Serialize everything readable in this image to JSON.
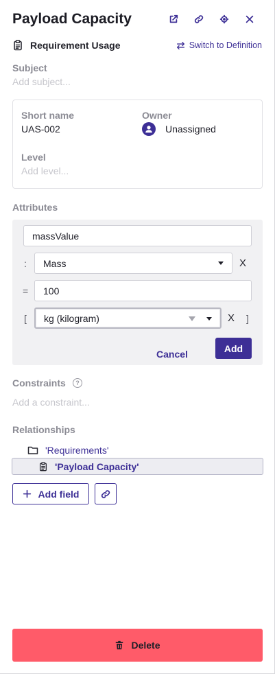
{
  "header": {
    "title": "Payload Capacity",
    "icons": [
      "external-link-icon",
      "link-icon",
      "target-icon",
      "close-icon"
    ]
  },
  "subheader": {
    "kind": "Requirement Usage",
    "switch_label": "Switch to Definition"
  },
  "subject": {
    "label": "Subject",
    "placeholder": "Add subject..."
  },
  "details": {
    "short_name_label": "Short name",
    "short_name_value": "UAS-002",
    "owner_label": "Owner",
    "owner_value": "Unassigned",
    "level_label": "Level",
    "level_placeholder": "Add level..."
  },
  "attributes": {
    "label": "Attributes",
    "name_value": "massValue",
    "type_symbol": ":",
    "type_value": "Mass",
    "equals_symbol": "=",
    "default_value": "100",
    "open_bracket": "[",
    "close_bracket": "]",
    "unit_value": "kg (kilogram)",
    "clear_glyph": "X",
    "cancel_label": "Cancel",
    "add_label": "Add"
  },
  "constraints": {
    "label": "Constraints",
    "help_glyph": "?",
    "placeholder": "Add a constraint..."
  },
  "relationships": {
    "label": "Relationships",
    "items": [
      {
        "label": "'Requirements'",
        "icon": "folder-icon"
      },
      {
        "label": "'Payload Capacity'",
        "icon": "clipboard-icon"
      }
    ]
  },
  "actions": {
    "add_field_label": "Add field",
    "delete_label": "Delete"
  },
  "colors": {
    "accent": "#3d2f96",
    "danger": "#ff5b69"
  }
}
